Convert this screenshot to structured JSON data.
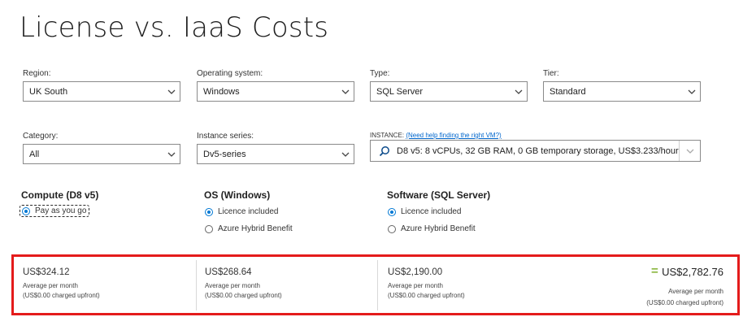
{
  "title": "License vs. IaaS Costs",
  "filters": {
    "region": {
      "label": "Region:",
      "value": "UK South"
    },
    "os": {
      "label": "Operating system:",
      "value": "Windows"
    },
    "type": {
      "label": "Type:",
      "value": "SQL Server"
    },
    "tier": {
      "label": "Tier:",
      "value": "Standard"
    },
    "category": {
      "label": "Category:",
      "value": "All"
    },
    "series": {
      "label": "Instance series:",
      "value": "Dv5-series"
    },
    "instance": {
      "label": "INSTANCE:",
      "help_link": "(Need help finding the right VM?)",
      "value": "D8 v5: 8 vCPUs, 32 GB RAM, 0 GB temporary storage, US$3.233/hour"
    }
  },
  "sections": {
    "compute": {
      "heading": "Compute (D8 v5)",
      "options": [
        "Pay as you go"
      ],
      "selected": 0
    },
    "os": {
      "heading": "OS (Windows)",
      "options": [
        "Licence included",
        "Azure Hybrid Benefit"
      ],
      "selected": 0
    },
    "software": {
      "heading": "Software (SQL Server)",
      "options": [
        "Licence included",
        "Azure Hybrid Benefit"
      ],
      "selected": 0
    }
  },
  "costs": {
    "compute": {
      "amount": "US$324.12",
      "period": "Average per month",
      "upfront": "(US$0.00 charged upfront)"
    },
    "os": {
      "amount": "US$268.64",
      "period": "Average per month",
      "upfront": "(US$0.00 charged upfront)"
    },
    "software": {
      "amount": "US$2,190.00",
      "period": "Average per month",
      "upfront": "(US$0.00 charged upfront)"
    },
    "total": {
      "equals": "=",
      "amount": "US$2,782.76",
      "period": "Average per month",
      "upfront": "(US$0.00 charged upfront)"
    }
  },
  "colors": {
    "accent": "#0078d4",
    "highlight_border": "#e41b1b",
    "equals": "#8ab63f",
    "link": "#0066cc"
  },
  "icons": {
    "select": "chevron-down-icon",
    "instance": "search-icon"
  }
}
